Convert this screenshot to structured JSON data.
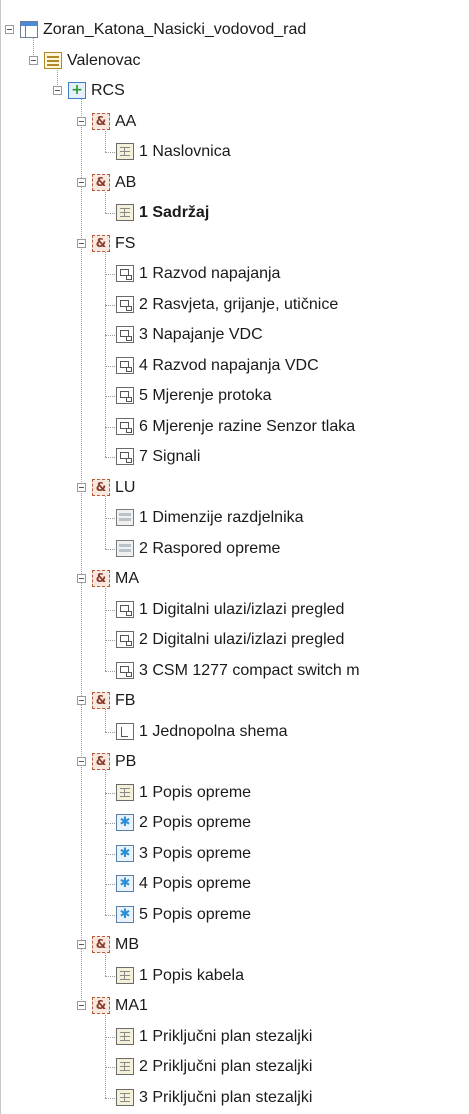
{
  "tree": [
    {
      "label": "Zoran_Katona_Nasicki_vodovod_rad",
      "level": 0,
      "icon": "project-icon",
      "expander": true
    },
    {
      "label": "Valenovac",
      "level": 1,
      "icon": "list-icon",
      "expander": true
    },
    {
      "label": "RCS",
      "level": 2,
      "icon": "rcs-icon",
      "expander": true
    },
    {
      "label": "AA",
      "level": 3,
      "icon": "ampersand-folder-icon",
      "expander": true
    },
    {
      "label": "1 Naslovnica",
      "level": 4,
      "icon": "title-page-icon",
      "expander": false
    },
    {
      "label": "AB",
      "level": 3,
      "icon": "ampersand-folder-icon",
      "expander": true
    },
    {
      "label": "1 Sadržaj",
      "level": 4,
      "icon": "title-page-icon",
      "expander": false,
      "bold": true
    },
    {
      "label": "FS",
      "level": 3,
      "icon": "ampersand-folder-icon",
      "expander": true
    },
    {
      "label": "1 Razvod napajanja",
      "level": 4,
      "icon": "schematic-page-icon",
      "expander": false
    },
    {
      "label": "2 Rasvjeta, grijanje, utičnice",
      "level": 4,
      "icon": "schematic-page-icon",
      "expander": false
    },
    {
      "label": "3 Napajanje  VDC",
      "level": 4,
      "icon": "schematic-page-icon",
      "expander": false
    },
    {
      "label": "4 Razvod napajanja  VDC",
      "level": 4,
      "icon": "schematic-page-icon",
      "expander": false
    },
    {
      "label": "5 Mjerenje protoka",
      "level": 4,
      "icon": "schematic-page-icon",
      "expander": false
    },
    {
      "label": "6 Mjerenje razine Senzor tlaka",
      "level": 4,
      "icon": "schematic-page-icon",
      "expander": false
    },
    {
      "label": "7 Signali",
      "level": 4,
      "icon": "schematic-page-icon",
      "expander": false
    },
    {
      "label": "LU",
      "level": 3,
      "icon": "ampersand-folder-icon",
      "expander": true
    },
    {
      "label": "1 Dimenzije razdjelnika",
      "level": 4,
      "icon": "layout-page-icon",
      "expander": false
    },
    {
      "label": "2 Raspored opreme",
      "level": 4,
      "icon": "layout-page-icon",
      "expander": false
    },
    {
      "label": "MA",
      "level": 3,
      "icon": "ampersand-folder-icon",
      "expander": true
    },
    {
      "label": "1 Digitalni ulazi/izlazi pregled",
      "level": 4,
      "icon": "schematic-page-icon",
      "expander": false
    },
    {
      "label": "2 Digitalni ulazi/izlazi pregled",
      "level": 4,
      "icon": "schematic-page-icon",
      "expander": false
    },
    {
      "label": "3 CSM 1277 compact switch m",
      "level": 4,
      "icon": "schematic-page-icon",
      "expander": false
    },
    {
      "label": "FB",
      "level": 3,
      "icon": "ampersand-folder-icon",
      "expander": true
    },
    {
      "label": "1 Jednopolna shema",
      "level": 4,
      "icon": "single-line-page-icon",
      "expander": false
    },
    {
      "label": "PB",
      "level": 3,
      "icon": "ampersand-folder-icon",
      "expander": true
    },
    {
      "label": "1 Popis opreme",
      "level": 4,
      "icon": "title-page-icon",
      "expander": false
    },
    {
      "label": "2 Popis opreme",
      "level": 4,
      "icon": "generated-report-icon",
      "expander": false
    },
    {
      "label": "3 Popis opreme",
      "level": 4,
      "icon": "generated-report-icon",
      "expander": false
    },
    {
      "label": "4 Popis opreme",
      "level": 4,
      "icon": "generated-report-icon",
      "expander": false
    },
    {
      "label": "5 Popis opreme",
      "level": 4,
      "icon": "generated-report-icon",
      "expander": false
    },
    {
      "label": "MB",
      "level": 3,
      "icon": "ampersand-folder-icon",
      "expander": true
    },
    {
      "label": "1 Popis kabela",
      "level": 4,
      "icon": "title-page-icon",
      "expander": false
    },
    {
      "label": "MA1",
      "level": 3,
      "icon": "ampersand-folder-icon",
      "expander": true
    },
    {
      "label": "1 Priključni plan stezaljki",
      "level": 4,
      "icon": "title-page-icon",
      "expander": false
    },
    {
      "label": "2 Priključni plan stezaljki",
      "level": 4,
      "icon": "title-page-icon",
      "expander": false
    },
    {
      "label": "3 Priključni plan stezaljki",
      "level": 4,
      "icon": "title-page-icon",
      "expander": false
    }
  ]
}
